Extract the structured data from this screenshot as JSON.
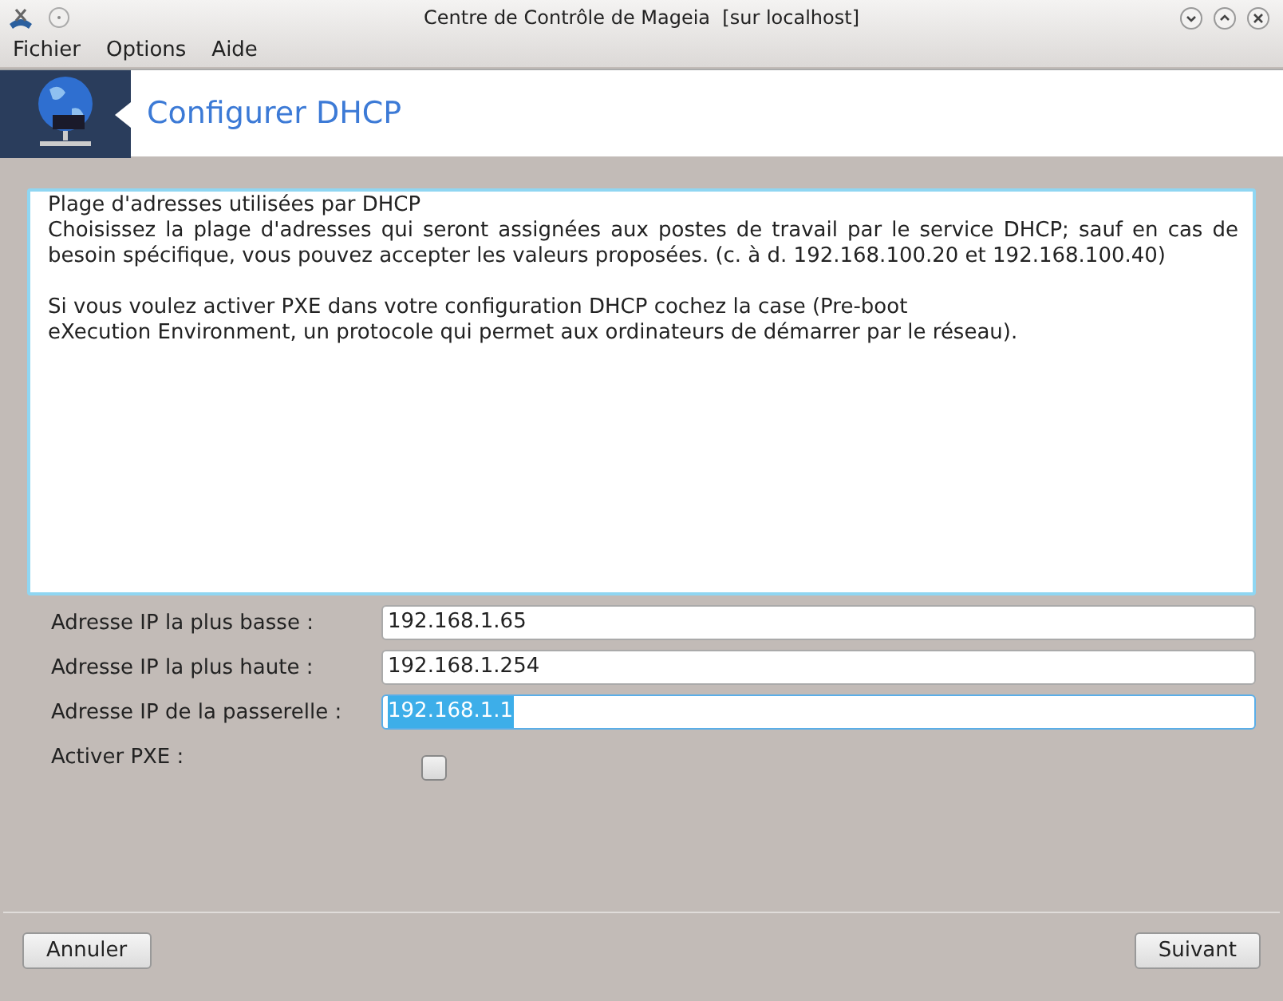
{
  "window": {
    "title": "Centre de Contrôle de Mageia  [sur localhost]"
  },
  "menu": [
    "Fichier",
    "Options",
    "Aide"
  ],
  "header": {
    "title": "Configurer DHCP"
  },
  "description": [
    {
      "lines": [
        "Plage d'adresses utilisées par DHCP",
        "Choisissez la plage d'adresses qui seront assignées aux postes de travail par le service DHCP; sauf en cas de besoin spécifique, vous pouvez accepter les valeurs proposées. (c. à d. 192.168.100.20 et 192.168.100.40)"
      ]
    },
    {
      "lines": [
        "Si vous voulez activer PXE dans votre configuration DHCP cochez la case (Pre-boot",
        "eXecution Environment, un protocole qui permet aux ordinateurs de démarrer par le réseau)."
      ]
    }
  ],
  "fields": [
    {
      "kind": "text",
      "label": "Adresse IP la plus basse :",
      "value": "192.168.1.65",
      "focused": false
    },
    {
      "kind": "text",
      "label": "Adresse IP la plus haute :",
      "value": "192.168.1.254",
      "focused": false
    },
    {
      "kind": "text",
      "label": "Adresse IP de la passerelle :",
      "value": "192.168.1.1",
      "focused": true
    },
    {
      "kind": "checkbox",
      "label": "Activer PXE :",
      "checked": false
    }
  ],
  "buttons": [
    "Annuler",
    "Suivant"
  ]
}
